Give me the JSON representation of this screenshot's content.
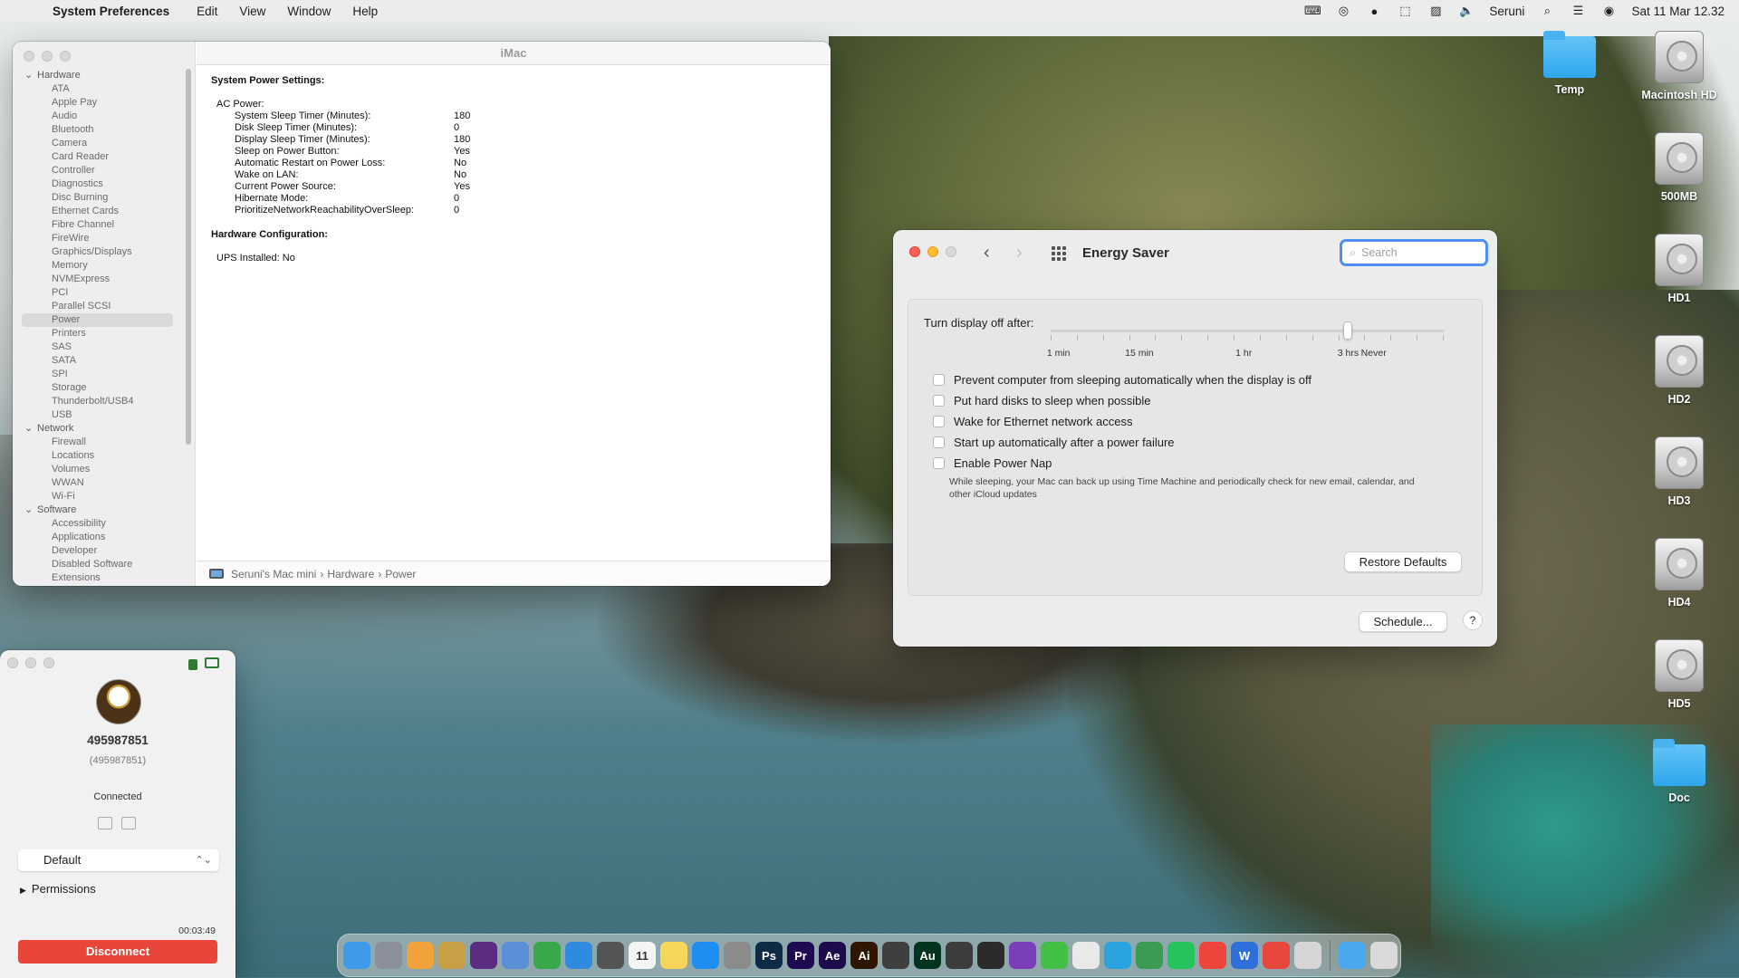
{
  "menubar": {
    "app_name": "System Preferences",
    "menus": [
      "Edit",
      "View",
      "Window",
      "Help"
    ],
    "user": "Seruni",
    "clock": "Sat 11 Mar  12.32",
    "status_icons": [
      "keyboard-icon",
      "creative-cloud-icon",
      "grammarly-icon",
      "cursor-icon",
      "activity-icon",
      "volume-icon"
    ]
  },
  "desktop": {
    "icons": [
      {
        "label": "Temp",
        "kind": "folder"
      },
      {
        "label": "Macintosh HD",
        "kind": "disk"
      },
      {
        "label": "500MB",
        "kind": "disk"
      },
      {
        "label": "HD1",
        "kind": "disk"
      },
      {
        "label": "HD2",
        "kind": "disk"
      },
      {
        "label": "HD3",
        "kind": "disk"
      },
      {
        "label": "HD4",
        "kind": "disk"
      },
      {
        "label": "HD5",
        "kind": "disk"
      },
      {
        "label": "Doc",
        "kind": "folder"
      }
    ]
  },
  "sysinfo": {
    "title": "iMac",
    "sidebar": [
      {
        "label": "Hardware",
        "header": true
      },
      {
        "label": "ATA"
      },
      {
        "label": "Apple Pay"
      },
      {
        "label": "Audio"
      },
      {
        "label": "Bluetooth"
      },
      {
        "label": "Camera"
      },
      {
        "label": "Card Reader"
      },
      {
        "label": "Controller"
      },
      {
        "label": "Diagnostics"
      },
      {
        "label": "Disc Burning"
      },
      {
        "label": "Ethernet Cards"
      },
      {
        "label": "Fibre Channel"
      },
      {
        "label": "FireWire"
      },
      {
        "label": "Graphics/Displays"
      },
      {
        "label": "Memory"
      },
      {
        "label": "NVMExpress"
      },
      {
        "label": "PCI"
      },
      {
        "label": "Parallel SCSI"
      },
      {
        "label": "Power",
        "selected": true
      },
      {
        "label": "Printers"
      },
      {
        "label": "SAS"
      },
      {
        "label": "SATA"
      },
      {
        "label": "SPI"
      },
      {
        "label": "Storage"
      },
      {
        "label": "Thunderbolt/USB4"
      },
      {
        "label": "USB"
      },
      {
        "label": "Network",
        "header": true
      },
      {
        "label": "Firewall"
      },
      {
        "label": "Locations"
      },
      {
        "label": "Volumes"
      },
      {
        "label": "WWAN"
      },
      {
        "label": "Wi-Fi"
      },
      {
        "label": "Software",
        "header": true
      },
      {
        "label": "Accessibility"
      },
      {
        "label": "Applications"
      },
      {
        "label": "Developer"
      },
      {
        "label": "Disabled Software"
      },
      {
        "label": "Extensions"
      }
    ],
    "section1": "System Power Settings:",
    "ac_label": "AC Power:",
    "settings": [
      {
        "k": "System Sleep Timer (Minutes):",
        "v": "180"
      },
      {
        "k": "Disk Sleep Timer (Minutes):",
        "v": "0"
      },
      {
        "k": "Display Sleep Timer (Minutes):",
        "v": "180"
      },
      {
        "k": "Sleep on Power Button:",
        "v": "Yes"
      },
      {
        "k": "Automatic Restart on Power Loss:",
        "v": "No"
      },
      {
        "k": "Wake on LAN:",
        "v": "No"
      },
      {
        "k": "Current Power Source:",
        "v": "Yes"
      },
      {
        "k": "Hibernate Mode:",
        "v": "0"
      },
      {
        "k": "PrioritizeNetworkReachabilityOverSleep:",
        "v": "0"
      }
    ],
    "section2": "Hardware Configuration:",
    "ups": "UPS Installed:   No",
    "breadcrumb": [
      "Seruni's Mac mini",
      "Hardware",
      "Power"
    ]
  },
  "energy": {
    "title": "Energy Saver",
    "search_placeholder": "Search",
    "slider_label": "Turn display off after:",
    "slider_value_hours": 3,
    "slider_ticks": [
      "1 min",
      "15 min",
      "1 hr",
      "3 hrs",
      "Never"
    ],
    "options": [
      {
        "label": "Prevent computer from sleeping automatically when the display is off",
        "checked": false
      },
      {
        "label": "Put hard disks to sleep when possible",
        "checked": false
      },
      {
        "label": "Wake for Ethernet network access",
        "checked": false
      },
      {
        "label": "Start up automatically after a power failure",
        "checked": false
      },
      {
        "label": "Enable Power Nap",
        "checked": false
      }
    ],
    "power_nap_note": "While sleeping, your Mac can back up using Time Machine and periodically check for new email, calendar, and other iCloud updates",
    "restore_button": "Restore Defaults",
    "schedule_button": "Schedule...",
    "help_button": "?"
  },
  "remote": {
    "user_id": "495987851",
    "user_sub": "(495987851)",
    "status": "Connected",
    "profile": "Default",
    "permissions": "Permissions",
    "timer": "00:03:49",
    "disconnect": "Disconnect"
  },
  "dock": {
    "apps": [
      {
        "name": "finder-icon",
        "label": "",
        "color": "#3d9be9"
      },
      {
        "name": "launchpad-icon",
        "label": "",
        "color": "#8a8f9a"
      },
      {
        "name": "pages-icon",
        "label": "",
        "color": "#f0a33a"
      },
      {
        "name": "app-icon",
        "label": "",
        "color": "#c7a046"
      },
      {
        "name": "imovie-icon",
        "label": "",
        "color": "#5a2d82"
      },
      {
        "name": "keynote-icon",
        "label": "",
        "color": "#5b8fd6"
      },
      {
        "name": "numbers-icon",
        "label": "",
        "color": "#38a84a"
      },
      {
        "name": "safari-icon",
        "label": "",
        "color": "#2f8bde"
      },
      {
        "name": "calculator-icon",
        "label": "",
        "color": "#545454"
      },
      {
        "name": "calendar-icon",
        "label": "11",
        "color": "#f4f4f4"
      },
      {
        "name": "notes-icon",
        "label": "",
        "color": "#f6d65a"
      },
      {
        "name": "appstore-icon",
        "label": "",
        "color": "#1e8ef2"
      },
      {
        "name": "system-preferences-icon",
        "label": "",
        "color": "#8b8b8b"
      },
      {
        "name": "photoshop-icon",
        "label": "Ps",
        "color": "#0d2b45"
      },
      {
        "name": "premiere-icon",
        "label": "Pr",
        "color": "#1d0a4f"
      },
      {
        "name": "after-effects-icon",
        "label": "Ae",
        "color": "#1c0a4d"
      },
      {
        "name": "illustrator-icon",
        "label": "Ai",
        "color": "#2e1600"
      },
      {
        "name": "final-cut-icon",
        "label": "",
        "color": "#3f3f3f"
      },
      {
        "name": "audition-icon",
        "label": "Au",
        "color": "#00341f"
      },
      {
        "name": "app2-icon",
        "label": "",
        "color": "#3c3c3c"
      },
      {
        "name": "davinci-icon",
        "label": "",
        "color": "#2b2b2b"
      },
      {
        "name": "app3-icon",
        "label": "",
        "color": "#7a3fb8"
      },
      {
        "name": "messages-icon",
        "label": "",
        "color": "#42c043"
      },
      {
        "name": "chrome-icon",
        "label": "",
        "color": "#e9e9e9"
      },
      {
        "name": "telegram-icon",
        "label": "",
        "color": "#2aa3df"
      },
      {
        "name": "app4-icon",
        "label": "",
        "color": "#3b9b53"
      },
      {
        "name": "whatsapp-icon",
        "label": "",
        "color": "#25c35b"
      },
      {
        "name": "anydesk-icon",
        "label": "",
        "color": "#ef443b"
      },
      {
        "name": "word-icon",
        "label": "W",
        "color": "#2e6fd9"
      },
      {
        "name": "app5-icon",
        "label": "",
        "color": "#e7473c"
      },
      {
        "name": "printer-icon",
        "label": "",
        "color": "#d6d6d6"
      }
    ],
    "trailing": [
      {
        "name": "downloads-folder-icon",
        "color": "#4aa9ee"
      },
      {
        "name": "trash-icon",
        "color": "#d8dada"
      }
    ]
  }
}
